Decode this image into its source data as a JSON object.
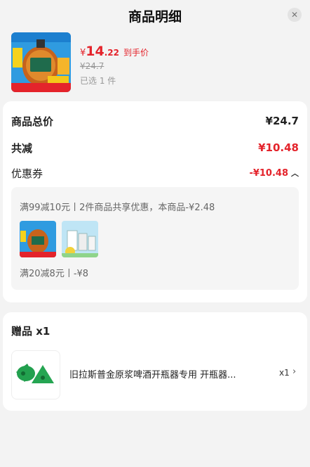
{
  "header": {
    "title": "商品明细",
    "close_icon": "close-icon"
  },
  "product": {
    "price_symbol": "¥",
    "price_int": "14",
    "price_dec": ".22",
    "price_tag": "到手价",
    "original_price": "¥24.7",
    "selected": "已选 1 件"
  },
  "summary": {
    "total_label": "商品总价",
    "total_value": "¥24.7",
    "discount_label": "共减",
    "discount_value": "¥10.48",
    "coupon_label": "优惠券",
    "coupon_value": "-¥10.48"
  },
  "coupons": {
    "line1": "满99减10元丨2件商品共享优惠，本商品-¥2.48",
    "line2": "满20减8元丨-¥8"
  },
  "gift": {
    "title": "赠品 x1",
    "name": "旧拉斯普金原浆啤酒开瓶器专用 开瓶器...",
    "qty": "x1"
  },
  "colors": {
    "accent_red": "#e4232b",
    "background": "#f3f3f3",
    "card": "#ffffff"
  }
}
